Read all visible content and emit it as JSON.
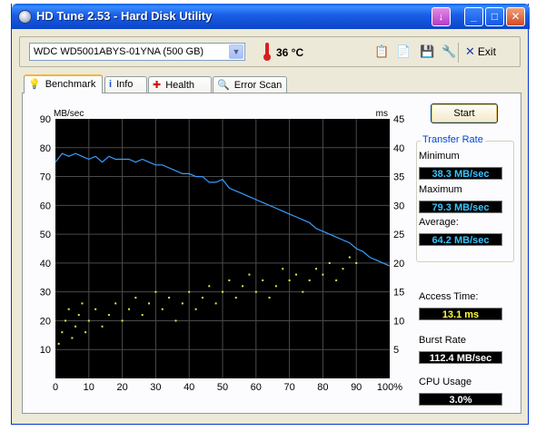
{
  "window": {
    "title": "HD Tune 2.53 - Hard Disk Utility",
    "title_buttons": {
      "hdtune": "↓",
      "minimize": "_",
      "maximize": "□",
      "close": "✕"
    }
  },
  "toolbar": {
    "drive": "WDC WD5001ABYS-01YNA (500 GB)",
    "temperature": "36 °C",
    "icons": [
      "copy-text-icon",
      "copy-image-icon",
      "save-icon",
      "options-icon"
    ],
    "exit_label": "Exit"
  },
  "tabs": [
    {
      "label": "Benchmark",
      "icon": "benchmark-icon",
      "active": true
    },
    {
      "label": "Info",
      "icon": "info-icon",
      "active": false
    },
    {
      "label": "Health",
      "icon": "health-icon",
      "active": false
    },
    {
      "label": "Error Scan",
      "icon": "error-scan-icon",
      "active": false
    }
  ],
  "benchmark": {
    "start_label": "Start",
    "transfer_rate_title": "Transfer Rate",
    "minimum_label": "Minimum",
    "minimum_value": "38.3 MB/sec",
    "maximum_label": "Maximum",
    "maximum_value": "79.3 MB/sec",
    "average_label": "Average:",
    "average_value": "64.2 MB/sec",
    "access_time_label": "Access Time:",
    "access_time_value": "13.1 ms",
    "burst_rate_label": "Burst Rate",
    "burst_rate_value": "112.4 MB/sec",
    "cpu_usage_label": "CPU Usage",
    "cpu_usage_value": "3.0%"
  },
  "chart_data": {
    "type": "line",
    "title": "",
    "ylabel_left": "MB/sec",
    "ylabel_right": "ms",
    "xlim": [
      0,
      100
    ],
    "ylim_left": [
      0,
      90
    ],
    "ylim_right": [
      0,
      45
    ],
    "x_ticks": [
      "0",
      "10",
      "20",
      "30",
      "40",
      "50",
      "60",
      "70",
      "80",
      "90",
      "100%"
    ],
    "y_ticks_left": [
      "10",
      "20",
      "30",
      "40",
      "50",
      "60",
      "70",
      "80",
      "90"
    ],
    "y_ticks_right": [
      "5",
      "10",
      "15",
      "20",
      "25",
      "30",
      "35",
      "40",
      "45"
    ],
    "grid": true,
    "background": "#000000",
    "grid_color": "#4a4a4a",
    "series": [
      {
        "type": "line",
        "color": "#3a9cff",
        "x": [
          0,
          2,
          4,
          6,
          8,
          10,
          12,
          14,
          16,
          18,
          20,
          22,
          24,
          26,
          28,
          30,
          32,
          34,
          36,
          38,
          40,
          42,
          44,
          46,
          48,
          50,
          52,
          54,
          56,
          58,
          60,
          62,
          64,
          66,
          68,
          70,
          72,
          74,
          76,
          78,
          80,
          82,
          84,
          86,
          88,
          90,
          92,
          94,
          96,
          98,
          100
        ],
        "y": [
          75,
          78,
          77,
          78,
          77,
          76,
          77,
          75,
          77,
          76,
          76,
          76,
          75,
          76,
          75,
          74,
          74,
          73,
          72,
          71,
          71,
          70,
          70,
          68,
          68,
          69,
          66,
          65,
          64,
          63,
          62,
          61,
          60,
          59,
          58,
          57,
          56,
          55,
          54,
          52,
          51,
          50,
          49,
          48,
          47,
          45,
          44,
          42,
          41,
          40,
          39
        ]
      },
      {
        "type": "scatter",
        "axis": "right",
        "color": "#e6e64a",
        "x": [
          1,
          2,
          3,
          4,
          5,
          6,
          7,
          8,
          9,
          10,
          12,
          14,
          16,
          18,
          20,
          22,
          24,
          26,
          28,
          30,
          32,
          34,
          36,
          38,
          40,
          42,
          44,
          46,
          48,
          50,
          52,
          54,
          56,
          58,
          60,
          62,
          64,
          66,
          68,
          70,
          72,
          74,
          76,
          78,
          80,
          82,
          84,
          86,
          88,
          90
        ],
        "y": [
          6,
          8,
          10,
          12,
          7,
          9,
          11,
          13,
          8,
          10,
          12,
          9,
          11,
          13,
          10,
          12,
          14,
          11,
          13,
          15,
          12,
          14,
          10,
          13,
          15,
          12,
          14,
          16,
          13,
          15,
          17,
          14,
          16,
          18,
          15,
          17,
          14,
          16,
          19,
          17,
          18,
          15,
          17,
          19,
          18,
          20,
          17,
          19,
          21,
          20
        ]
      }
    ]
  }
}
